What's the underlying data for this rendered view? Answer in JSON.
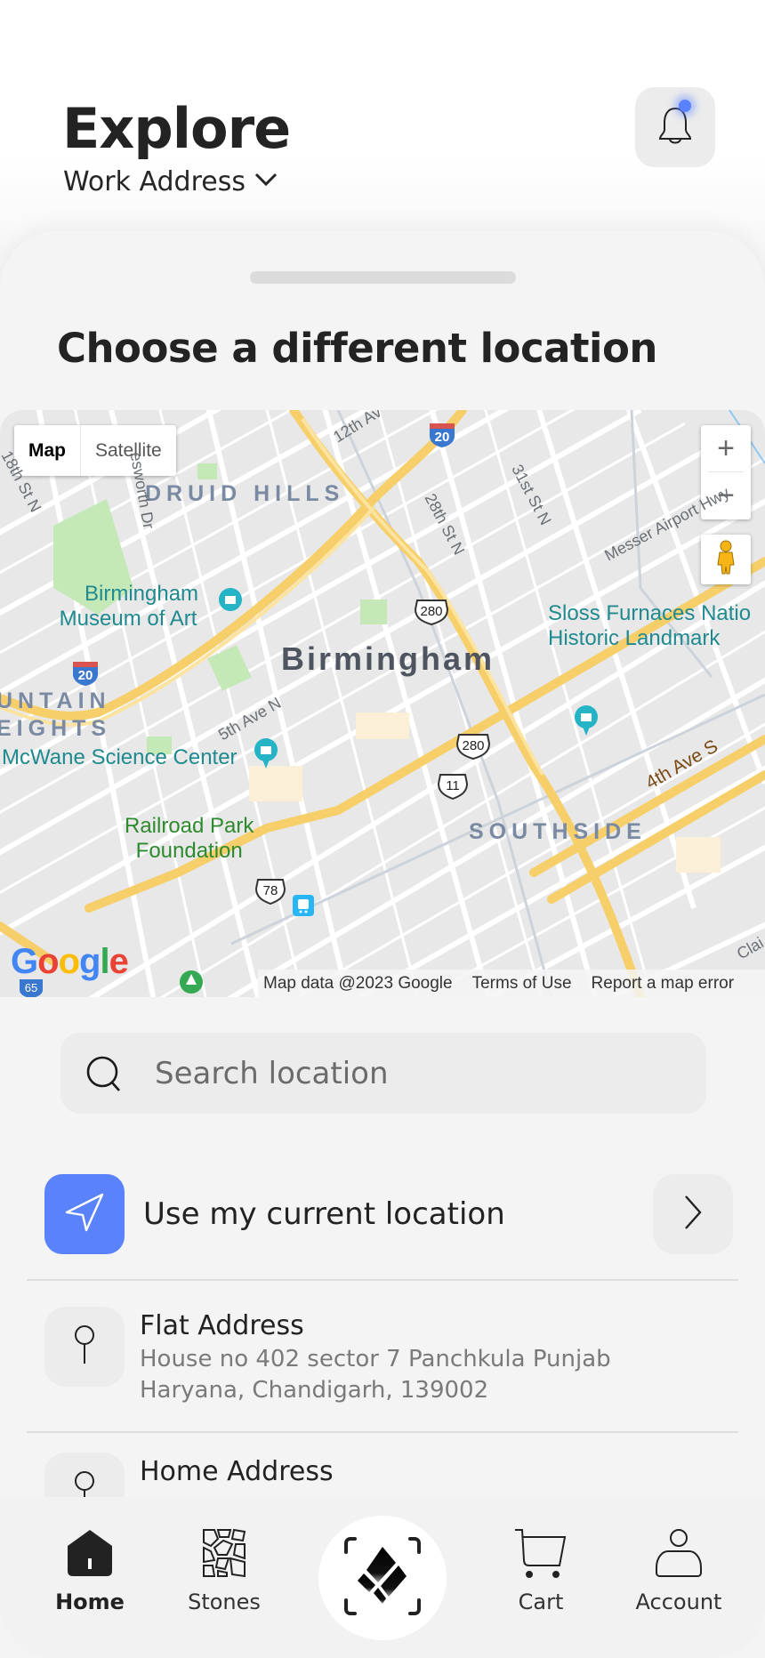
{
  "header": {
    "title": "Explore",
    "address_selector": "Work Address",
    "notification_badge_color": "#5a82ff"
  },
  "sheet": {
    "title": "Choose a different location"
  },
  "map": {
    "type_buttons": [
      "Map",
      "Satellite"
    ],
    "active_type": "Map",
    "zoom_in": "+",
    "zoom_out": "−",
    "labels": {
      "druid_hills": "DRUID HILLS",
      "birmingham": "Birmingham",
      "museum": [
        "Birmingham",
        "Museum of Art"
      ],
      "sloss": [
        "Sloss Furnaces Natio",
        "Historic Landmark"
      ],
      "fountain": [
        "UNTAIN",
        "EIGHTS"
      ],
      "mcwane": "McWane Science Center",
      "railroad": [
        "Railroad Park",
        "Foundation"
      ],
      "southside": "SOUTHSIDE",
      "st_12th": "12th Av",
      "st_28th": "28th St N",
      "st_31st": "31st St N",
      "st_18th": "18th St N",
      "st_esworth": "esworth Dr",
      "messer": "Messer Airport Hwy",
      "ave_5th": "5th Ave N",
      "ave_4th_s": "4th Ave S",
      "clai": "Clai"
    },
    "shields": {
      "i20_a": "20",
      "i20_b": "20",
      "us280_a": "280",
      "us280_b": "280",
      "us11": "11",
      "us78": "78",
      "i65": "65"
    },
    "google_logo": "Google",
    "footer": {
      "map_data": "Map data @2023 Google",
      "terms": "Terms of Use",
      "report": "Report a map error"
    }
  },
  "search": {
    "placeholder": "Search location"
  },
  "current_location": {
    "label": "Use my current location",
    "accent": "#5a82fa"
  },
  "saved_addresses": [
    {
      "title": "Flat Address",
      "line1": "House no 402 sector 7 Panchkula Punjab",
      "line2": "Haryana, Chandigarh, 139002"
    },
    {
      "title": "Home Address"
    }
  ],
  "bottom_nav": {
    "items": [
      {
        "label": "Home",
        "icon": "home-icon",
        "active": true
      },
      {
        "label": "Stones",
        "icon": "stones-icon",
        "active": false
      },
      {
        "label": "Cart",
        "icon": "cart-icon",
        "active": false
      },
      {
        "label": "Account",
        "icon": "account-icon",
        "active": false
      }
    ],
    "center_action": "scan-icon"
  }
}
